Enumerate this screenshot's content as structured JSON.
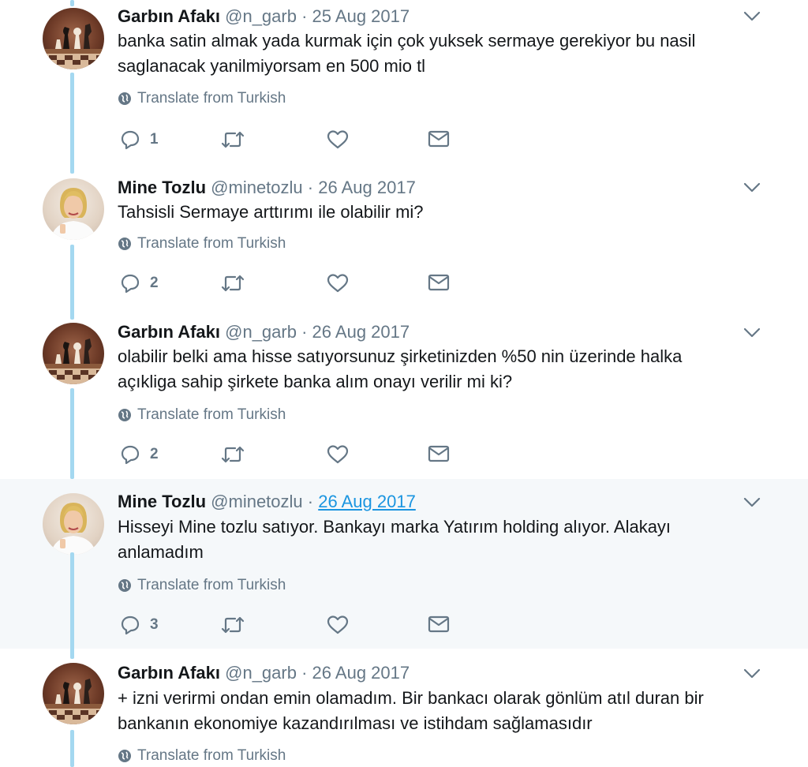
{
  "tweets": [
    {
      "name": "Garbın Afakı",
      "handle": "@n_garb",
      "separator": "·",
      "date": "25 Aug 2017",
      "avatar_icon": "chess-icon",
      "text_lines": [
        "banka satin almak yada kurmak için çok yuksek sermaye gerekiyor bu nasil",
        "saglanacak  yanilmiyorsam en 500 mio tl"
      ],
      "translate": "Translate from Turkish",
      "reply_count": "1"
    },
    {
      "name": "Mine Tozlu",
      "handle": "@minetozlu",
      "separator": "·",
      "date": "26 Aug 2017",
      "avatar_icon": "portrait-icon",
      "text_lines": [
        "Tahsisli Sermaye arttırımı ile olabilir mi?"
      ],
      "translate": "Translate from Turkish",
      "reply_count": "2"
    },
    {
      "name": "Garbın Afakı",
      "handle": "@n_garb",
      "separator": "·",
      "date": "26 Aug 2017",
      "avatar_icon": "chess-icon",
      "text_lines": [
        "olabilir belki ama hisse satıyorsunuz şirketinizden %50 nin üzerinde halka",
        "açıkliga sahip şirkete banka alım onayı verilir mi ki?"
      ],
      "translate": "Translate from Turkish",
      "reply_count": "2"
    },
    {
      "name": "Mine Tozlu",
      "handle": "@minetozlu",
      "separator": "·",
      "date": "26 Aug 2017",
      "avatar_icon": "portrait-icon",
      "text_lines": [
        "Hisseyi Mine tozlu satıyor. Bankayı marka Yatırım holding alıyor. Alakayı",
        "anlamadım"
      ],
      "translate": "Translate from Turkish",
      "reply_count": "3",
      "highlighted": true
    },
    {
      "name": "Garbın Afakı",
      "handle": "@n_garb",
      "separator": "·",
      "date": "26 Aug 2017",
      "avatar_icon": "chess-icon",
      "text_lines": [
        "+ izni verirmi ondan emin olamadım. Bir bankacı olarak gönlüm atıl duran bir",
        "bankanın ekonomiye kazandırılması ve istihdam sağlamasıdır"
      ],
      "translate": "Translate from Turkish"
    }
  ],
  "colors": {
    "thread_line": "#a4d8f0",
    "link": "#1b95e0",
    "muted": "#657786",
    "highlight_bg": "#f5f8fa"
  }
}
